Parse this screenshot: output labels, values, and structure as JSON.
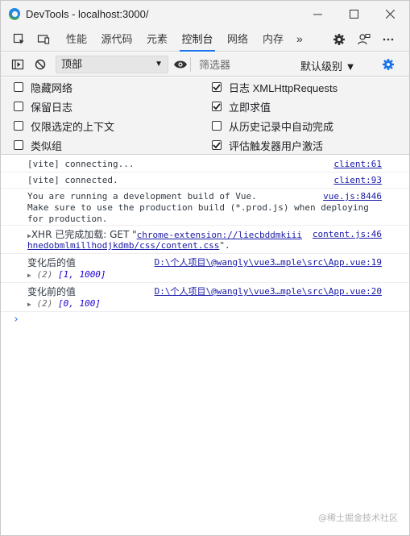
{
  "window": {
    "title": "DevTools - localhost:3000/",
    "icon": "edge-devtools-icon",
    "controls": {
      "minimize": "—",
      "maximize": "☐",
      "close": "✕"
    }
  },
  "tabs": {
    "items": [
      {
        "label": "性能",
        "active": false
      },
      {
        "label": "源代码",
        "active": false
      },
      {
        "label": "元素",
        "active": false
      },
      {
        "label": "控制台",
        "active": true
      },
      {
        "label": "网络",
        "active": false
      },
      {
        "label": "内存",
        "active": false
      }
    ],
    "more": "»"
  },
  "console_toolbar": {
    "context": "顶部",
    "filter_placeholder": "筛选器",
    "levels": "默认级别 ▼"
  },
  "settings": {
    "left": [
      {
        "label": "隐藏网络",
        "checked": false
      },
      {
        "label": "保留日志",
        "checked": false
      },
      {
        "label": "仅限选定的上下文",
        "checked": false
      },
      {
        "label": "类似组",
        "checked": false
      }
    ],
    "right": [
      {
        "label": "日志 XMLHttpRequests",
        "checked": true
      },
      {
        "label": "立即求值",
        "checked": true
      },
      {
        "label": "从历史记录中自动完成",
        "checked": false
      },
      {
        "label": "评估触发器用户激活",
        "checked": true
      }
    ]
  },
  "messages": [
    {
      "text": "[vite] connecting...",
      "source": "client:61"
    },
    {
      "text": "[vite] connected.",
      "source": "client:93"
    },
    {
      "text": "You are running a development build of Vue.\nMake sure to use the production build (*.prod.js) when deploying\nfor production.",
      "source": "vue.js:8446"
    },
    {
      "prefix": "XHR 已完成加载: GET \"",
      "url": "chrome-extension://liecbddmkiii",
      "url2": "hnedobmlmillhodjkdmb/css/content.css",
      "suffix": "\".",
      "source": "content.js:46"
    },
    {
      "label": "变化后的值",
      "source": "D:\\个人项目\\@wangly\\vue3…mple\\src\\App.vue:19",
      "len": "(2)",
      "value": "[1, 1000]"
    },
    {
      "label": "变化前的值",
      "source": "D:\\个人项目\\@wangly\\vue3…mple\\src\\App.vue:20",
      "len": "(2)",
      "value": "[0, 100]"
    }
  ],
  "prompt_symbol": "›",
  "watermark": "@稀土掘金技术社区"
}
